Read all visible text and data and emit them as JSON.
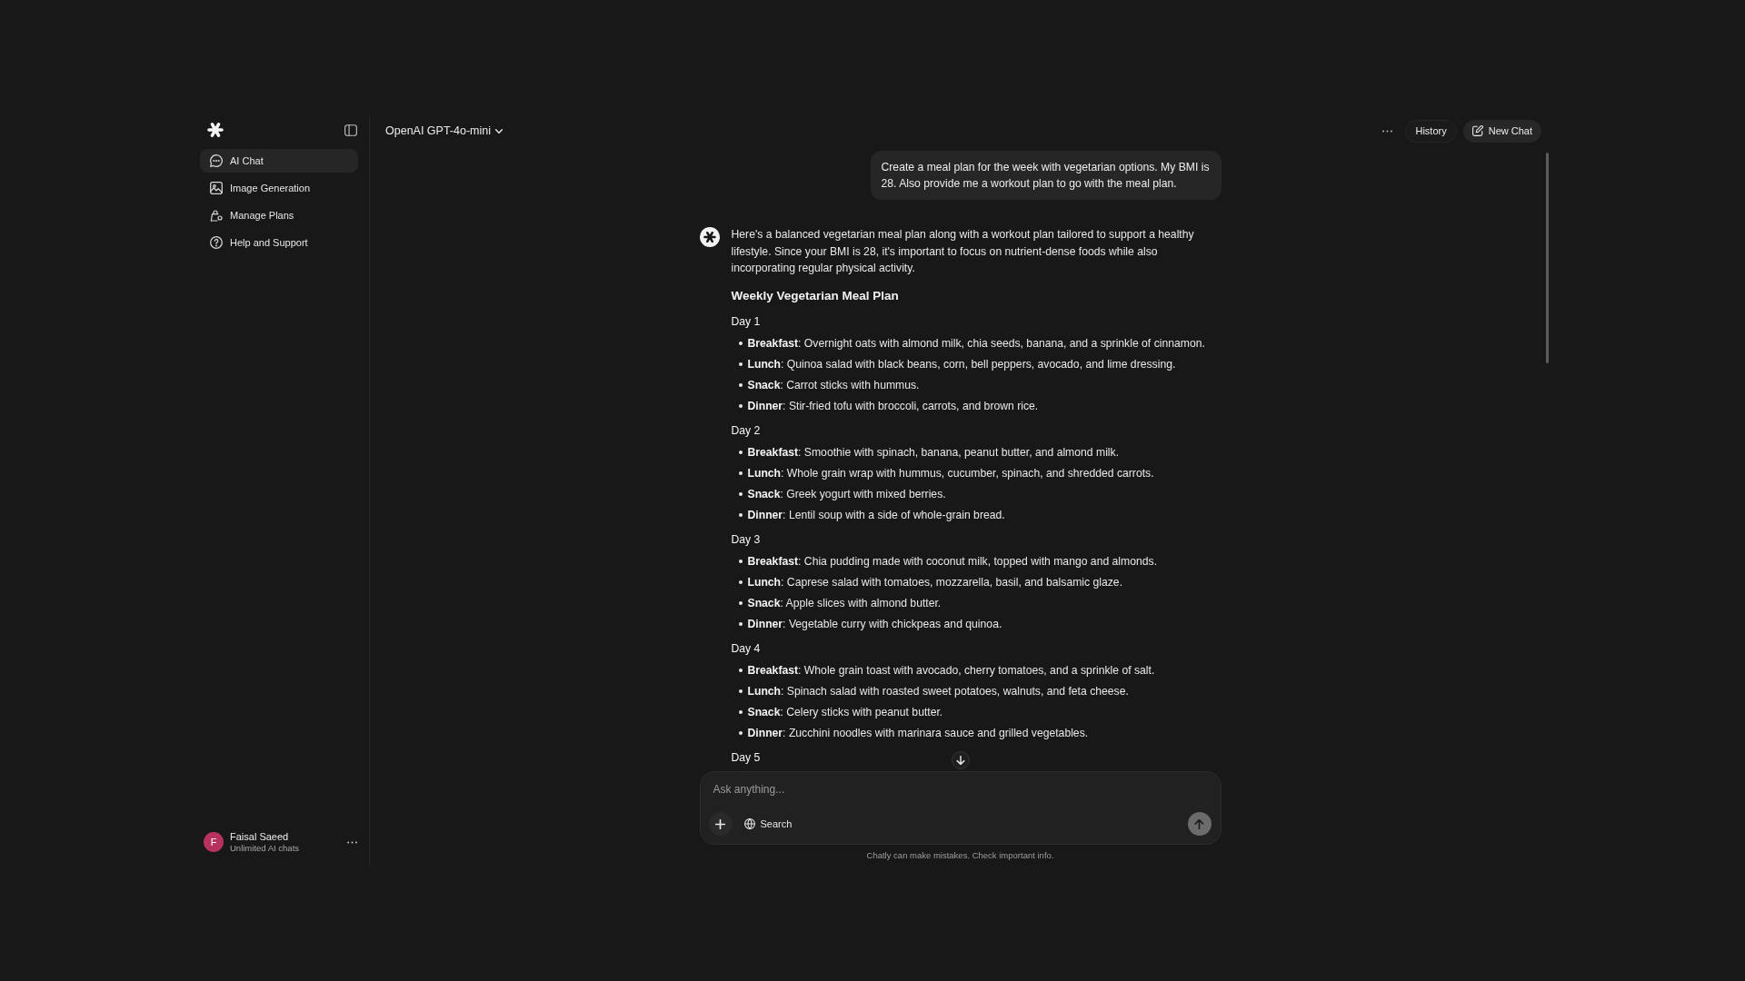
{
  "sidebar": {
    "items": [
      {
        "label": "AI Chat",
        "selected": true
      },
      {
        "label": "Image Generation",
        "selected": false
      },
      {
        "label": "Manage Plans",
        "selected": false
      },
      {
        "label": "Help and Support",
        "selected": false
      }
    ],
    "user": {
      "initial": "F",
      "name": "Faisal Saeed",
      "plan": "Unlimited AI chats"
    }
  },
  "header": {
    "model": "OpenAI GPT-4o-mini",
    "buttons": [
      {
        "label": "History",
        "kind": "outline"
      },
      {
        "label": "New Chat",
        "kind": "new"
      }
    ]
  },
  "messages": [
    {
      "kind": "user",
      "text": "Create a meal plan for the week with vegetarian options. My BMI is 28. Also provide me a workout plan to go with the meal plan."
    },
    {
      "kind": "assistant",
      "blocks": [
        {
          "kind": "paragraph",
          "text": "Here's a balanced vegetarian meal plan along with a workout plan tailored to support a healthy lifestyle. Since your BMI is 28, it's important to focus on nutrient-dense foods while also incorporating regular physical activity."
        },
        {
          "kind": "heading",
          "text": "Weekly Vegetarian Meal Plan"
        },
        {
          "kind": "day",
          "title": "Day 1",
          "items": [
            "**Breakfast**: Overnight oats with almond milk, chia seeds, banana, and a sprinkle of cinnamon.",
            "**Lunch**: Quinoa salad with black beans, corn, bell peppers, avocado, and lime dressing.",
            "**Snack**: Carrot sticks with hummus.",
            "**Dinner**: Stir-fried tofu with broccoli, carrots, and brown rice."
          ]
        },
        {
          "kind": "day",
          "title": "Day 2",
          "items": [
            "**Breakfast**: Smoothie with spinach, banana, peanut butter, and almond milk.",
            "**Lunch**: Whole grain wrap with hummus, cucumber, spinach, and shredded carrots.",
            "**Snack**: Greek yogurt with mixed berries.",
            "**Dinner**: Lentil soup with a side of whole-grain bread."
          ]
        },
        {
          "kind": "day",
          "title": "Day 3",
          "items": [
            "**Breakfast**: Chia pudding made with coconut milk, topped with mango and almonds.",
            "**Lunch**: Caprese salad with tomatoes, mozzarella, basil, and balsamic glaze.",
            "**Snack**: Apple slices with almond butter.",
            "**Dinner**: Vegetable curry with chickpeas and quinoa."
          ]
        },
        {
          "kind": "day",
          "title": "Day 4",
          "items": [
            "**Breakfast**: Whole grain toast with avocado, cherry tomatoes, and a sprinkle of salt.",
            "**Lunch**: Spinach salad with roasted sweet potatoes, walnuts, and feta cheese.",
            "**Snack**: Celery sticks with peanut butter.",
            "**Dinner**: Zucchini noodles with marinara sauce and grilled vegetables."
          ]
        },
        {
          "kind": "day",
          "title": "Day 5"
        }
      ]
    }
  ],
  "composer": {
    "placeholder": "Ask anything...",
    "search_label": "Search"
  },
  "disclaimer": "Chatly can make mistakes. Check important info."
}
